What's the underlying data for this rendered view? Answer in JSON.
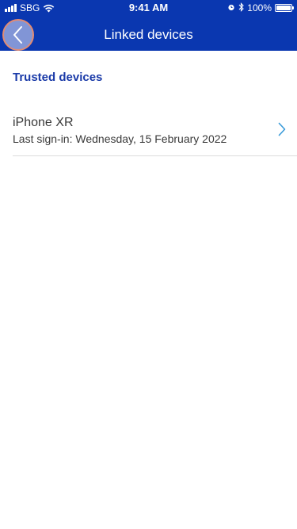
{
  "status_bar": {
    "carrier": "SBG",
    "time": "9:41 AM",
    "battery_percent": "100%",
    "battery_level": 1.0,
    "icons": [
      "signal-icon",
      "wifi-icon",
      "alarm-icon",
      "bluetooth-icon",
      "battery-icon"
    ]
  },
  "nav": {
    "title": "Linked devices",
    "back_icon": "chevron-left-icon"
  },
  "section": {
    "title": "Trusted devices"
  },
  "devices": [
    {
      "name": "iPhone XR",
      "last_sign_in": "Last sign-in: Wednesday, 15 February 2022",
      "icon": "chevron-right-icon"
    }
  ],
  "colors": {
    "header_bg": "#0a37b0",
    "section_title": "#1a3aa8",
    "chevron": "#3a9bd9",
    "back_button_bg": "#8195d6",
    "back_button_border": "#e28b73"
  }
}
